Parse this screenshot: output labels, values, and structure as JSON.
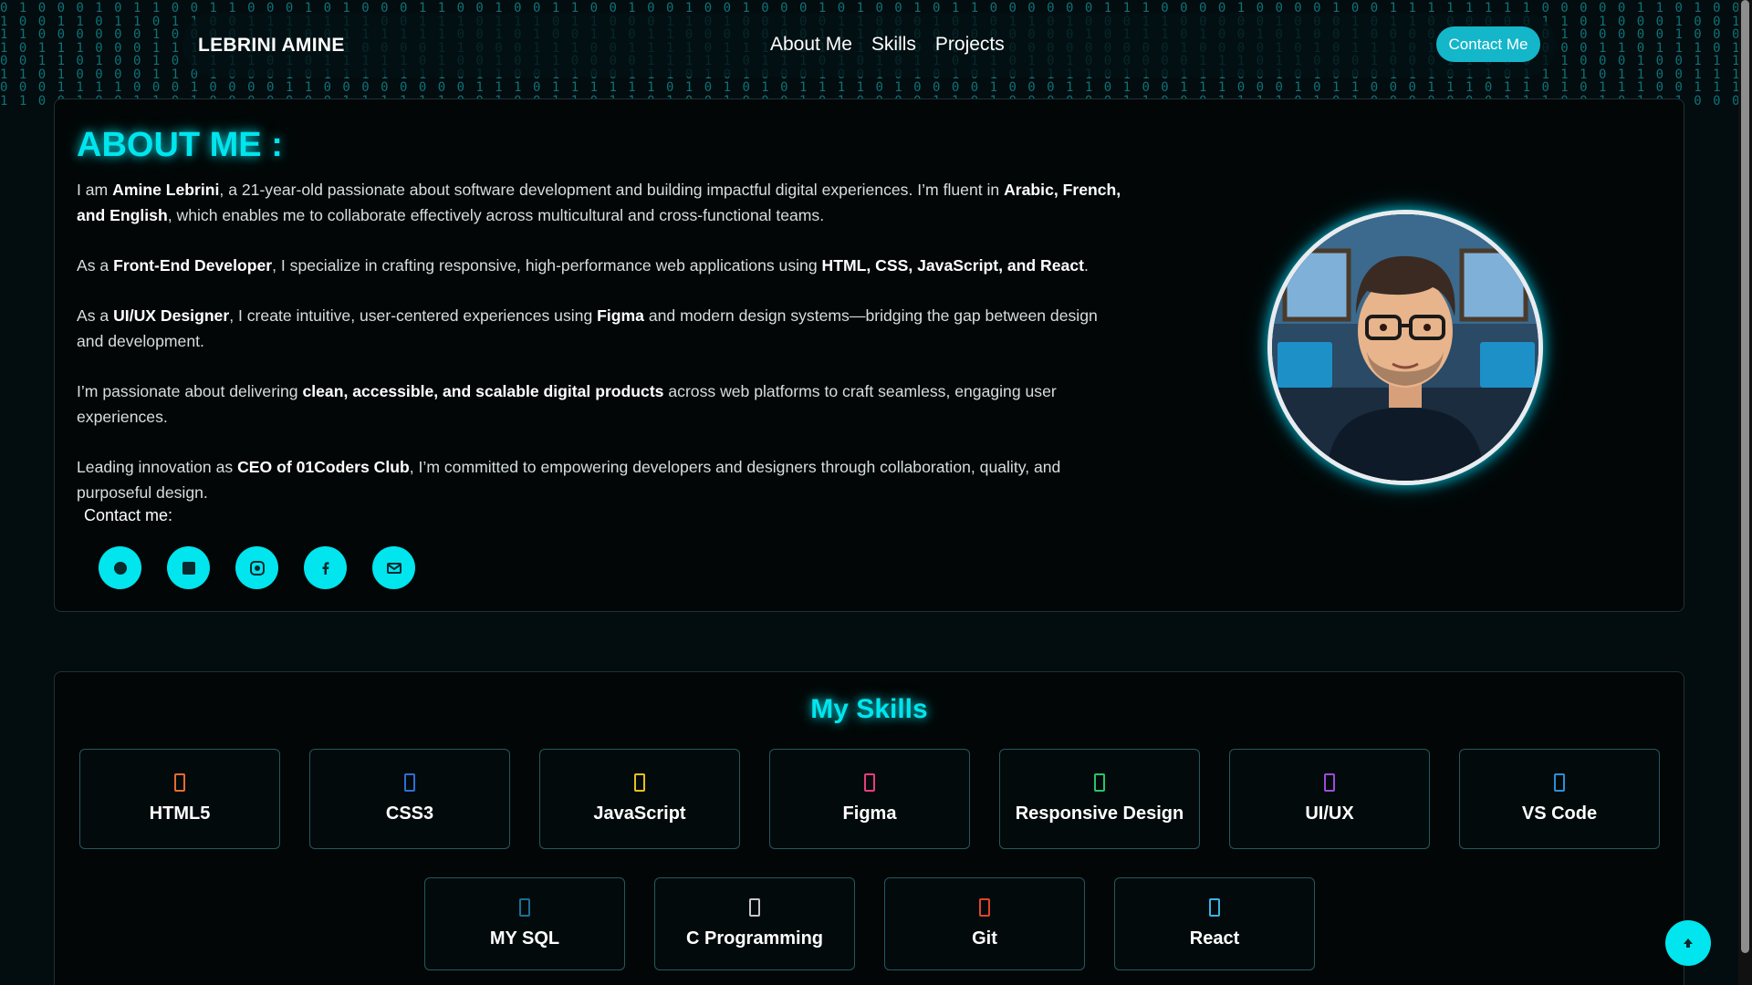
{
  "navbar": {
    "brand": "LEBRINI AMINE",
    "links": [
      "About Me",
      "Skills",
      "Projects"
    ],
    "contact_button": "Contact Me"
  },
  "about": {
    "title": "ABOUT ME :",
    "p1": {
      "t1": "I am ",
      "b1": "Amine Lebrini",
      "t2": ", a 21-year-old passionate about software development and building impactful digital experiences. I’m fluent in ",
      "b2": "Arabic, French, and English",
      "t3": ", which enables me to collaborate effectively across multicultural and cross-functional teams."
    },
    "p2": {
      "t1": "As a ",
      "b1": "Front-End Developer",
      "t2": ", I specialize in crafting responsive, high-performance web applications using ",
      "b2": "HTML, CSS, JavaScript, and React",
      "t3": "."
    },
    "p3": {
      "t1": "As a ",
      "b1": "UI/UX Designer",
      "t2": ", I create intuitive, user-centered experiences using ",
      "b2": "Figma",
      "t3": " and modern design systems—bridging the gap between design and development."
    },
    "p4": {
      "t1": "I’m passionate about delivering ",
      "b1": "clean, accessible, and scalable digital products",
      "t2": " across web platforms to craft seamless, engaging user experiences."
    },
    "p5": {
      "t1": "Leading innovation as ",
      "b1": "CEO of 01Coders Club",
      "t2": ", I’m committed to empowering developers and designers through collaboration, quality, and purposeful design."
    },
    "contact_label": "Contact me:",
    "socials": [
      "github-icon",
      "linkedin-icon",
      "instagram-icon",
      "facebook-icon",
      "email-icon"
    ]
  },
  "skills": {
    "title": "My Skills",
    "items": [
      {
        "name": "HTML5",
        "icon": "html5-icon",
        "color": "#e86b2f"
      },
      {
        "name": "CSS3",
        "icon": "css3-icon",
        "color": "#2d6fd6"
      },
      {
        "name": "JavaScript",
        "icon": "javascript-icon",
        "color": "#e3c31a"
      },
      {
        "name": "Figma",
        "icon": "figma-icon",
        "color": "#e53e7b"
      },
      {
        "name": "Responsive Design",
        "icon": "mobile-icon",
        "color": "#27c46b"
      },
      {
        "name": "UI/UX",
        "icon": "palette-icon",
        "color": "#9c4bdc"
      },
      {
        "name": "VS Code",
        "icon": "code-icon",
        "color": "#2c8fd6"
      },
      {
        "name": "MY SQL",
        "icon": "database-icon",
        "color": "#1b6f95"
      },
      {
        "name": "C Programming",
        "icon": "c-icon",
        "color": "#c7c7c7"
      },
      {
        "name": "Git",
        "icon": "git-icon",
        "color": "#e0442a"
      },
      {
        "name": "React",
        "icon": "react-icon",
        "color": "#39b3e6"
      }
    ]
  },
  "colors": {
    "accent": "#00e5ee",
    "button": "#14b6c9",
    "background": "#030c0e"
  }
}
